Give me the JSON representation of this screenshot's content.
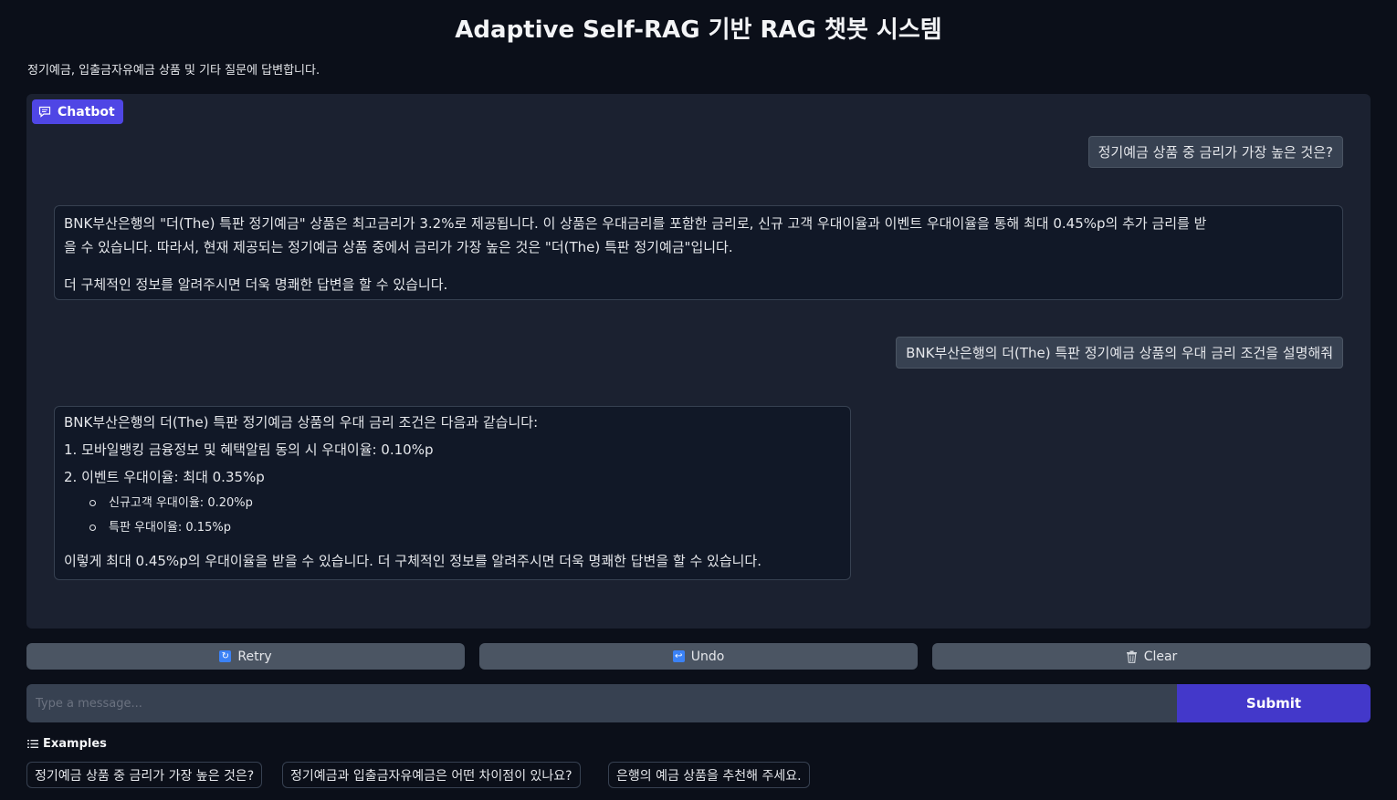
{
  "header": {
    "title": "Adaptive Self-RAG 기반 RAG 챗봇 시스템",
    "subtitle": "정기예금, 입출금자유예금 상품 및 기타 질문에 답변합니다."
  },
  "chatbot": {
    "label": "Chatbot",
    "messages": [
      {
        "role": "user",
        "text": "정기예금 상품 중 금리가 가장 높은 것은?"
      },
      {
        "role": "bot",
        "line1": "BNK부산은행의 \"더(The) 특판 정기예금\" 상품은 최고금리가 3.2%로 제공됩니다. 이 상품은 우대금리를 포함한 금리로, 신규 고객 우대이율과 이벤트 우대이율을 통해 최대 0.45%p의 추가 금리를 받",
        "line2": "을 수 있습니다. 따라서, 현재 제공되는 정기예금 상품 중에서 금리가 가장 높은 것은 \"더(The) 특판 정기예금\"입니다.",
        "line3": "더 구체적인 정보를 알려주시면 더욱 명쾌한 답변을 할 수 있습니다."
      },
      {
        "role": "user",
        "text": "BNK부산은행의 더(The) 특판 정기예금 상품의 우대 금리 조건을 설명해줘"
      },
      {
        "role": "bot",
        "intro": "BNK부산은행의 더(The) 특판 정기예금 상품의 우대 금리 조건은 다음과 같습니다:",
        "item1": "1. 모바일뱅킹 금융정보 및 혜택알림 동의 시 우대이율: 0.10%p",
        "item2": "2. 이벤트 우대이율: 최대 0.35%p",
        "sub1": "신규고객 우대이율: 0.20%p",
        "sub2": "특판 우대이율: 0.15%p",
        "outro": "이렇게 최대 0.45%p의 우대이율을 받을 수 있습니다. 더 구체적인 정보를 알려주시면 더욱 명쾌한 답변을 할 수 있습니다."
      }
    ]
  },
  "actions": {
    "retry": {
      "label": "Retry",
      "icon": "retry-icon",
      "color": "#3b82f6"
    },
    "undo": {
      "label": "Undo",
      "icon": "undo-icon",
      "color": "#3b82f6"
    },
    "clear": {
      "label": "Clear",
      "icon": "trash-icon",
      "color": "#9ca3af"
    }
  },
  "input": {
    "placeholder": "Type a message...",
    "submit_label": "Submit"
  },
  "examples": {
    "heading": "Examples",
    "items": [
      "정기예금 상품 중 금리가 가장 높은 것은?",
      "정기예금과 입출금자유예금은 어떤 차이점이 있나요?",
      "은행의 예금 상품을 추천해 주세요."
    ]
  },
  "colors": {
    "background": "#0b0f19",
    "panel": "#1b2130",
    "accent": "#4f46e5",
    "submit": "#4338ca"
  }
}
